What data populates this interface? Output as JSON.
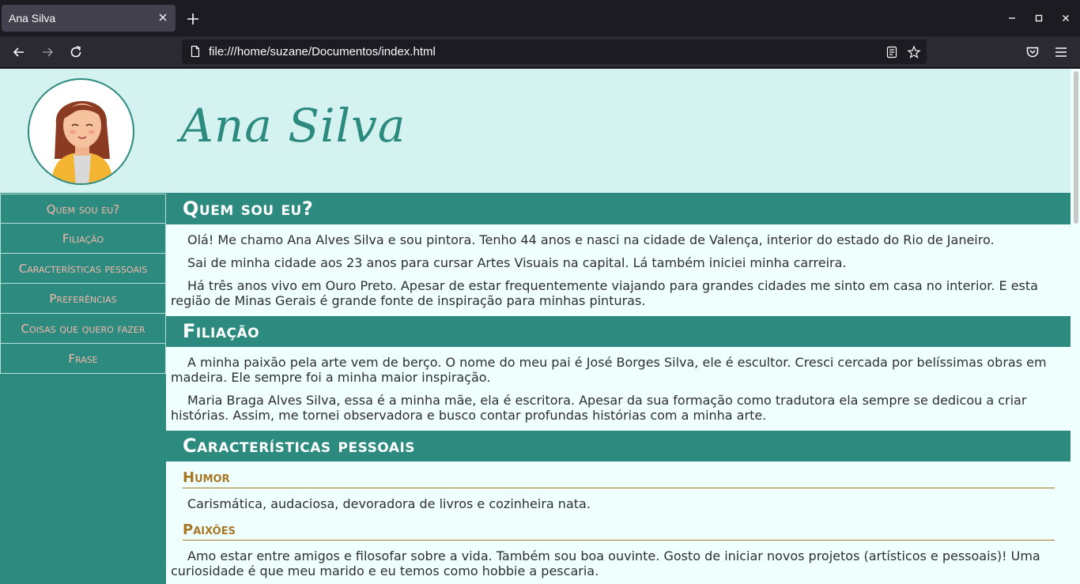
{
  "browser": {
    "tab_title": "Ana Silva",
    "url": "file:///home/suzane/Documentos/index.html"
  },
  "header": {
    "title": "Ana Silva"
  },
  "sidebar": {
    "items": [
      {
        "label": "Quem sou eu?"
      },
      {
        "label": "Filiação"
      },
      {
        "label": "Características pessoais"
      },
      {
        "label": "Preferências"
      },
      {
        "label": "Coisas que quero fazer"
      },
      {
        "label": "Frase"
      }
    ]
  },
  "content": {
    "quem": {
      "heading": "Quem sou eu?",
      "p1": "Olá! Me chamo Ana Alves Silva e sou pintora. Tenho 44 anos e nasci na cidade de Valença, interior do estado do Rio de Janeiro.",
      "p2": "Sai de minha cidade aos 23 anos para cursar Artes Visuais na capital. Lá também iniciei minha carreira.",
      "p3": "Há três anos vivo em Ouro Preto. Apesar de estar frequentemente viajando para grandes cidades me sinto em casa no interior. E esta região de Minas Gerais é grande fonte de inspiração para minhas pinturas."
    },
    "filiacao": {
      "heading": "Filiação",
      "p1": "A minha paixão pela arte vem de berço. O nome do meu pai é José Borges Silva, ele é escultor. Cresci cercada por belíssimas obras em madeira. Ele sempre foi a minha maior inspiração.",
      "p2": "Maria Braga Alves Silva, essa é a minha mãe, ela é escritora. Apesar da sua formação como tradutora ela sempre se dedicou a criar histórias. Assim, me tornei observadora e busco contar profundas histórias com a minha arte."
    },
    "caracteristicas": {
      "heading": "Características pessoais",
      "humor_heading": "Humor",
      "humor_text": "Carismática, audaciosa, devoradora de livros e cozinheira nata.",
      "paixoes_heading": "Paixões",
      "paixoes_text": "Amo estar entre amigos e filosofar sobre a vida. Também sou boa ouvinte. Gosto de iniciar novos projetos (artísticos e pessoais)! Uma curiosidade é que meu marido e eu temos como hobbie a pescaria."
    }
  },
  "colors": {
    "accent": "#2d8a7f",
    "header_bg": "#d4f3f0",
    "menu_text": "#f5b7ab",
    "subheading": "#a87825"
  }
}
